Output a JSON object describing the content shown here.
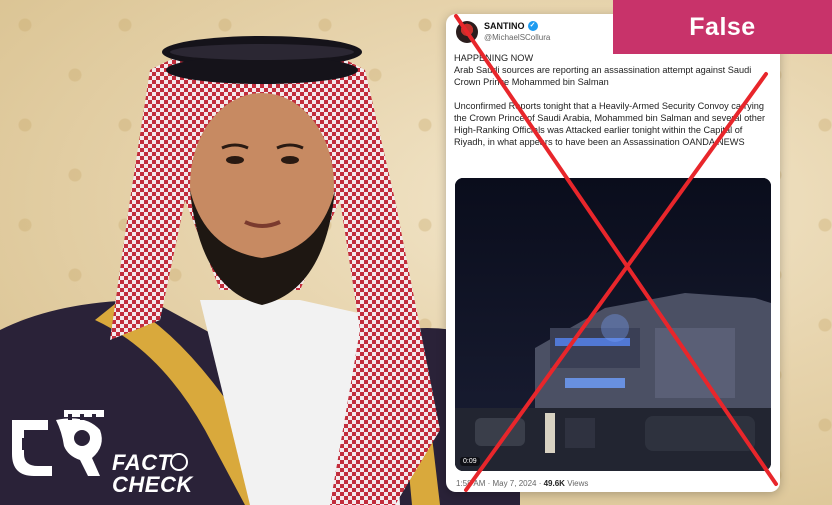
{
  "verdict": {
    "label": "False",
    "color": "#c8336a"
  },
  "tweet": {
    "display_name": "SANTINO",
    "handle": "@MichaelSCollura",
    "paragraphs": [
      "HAPPENING NOW\nArab Saudi sources are reporting an assassination attempt against Saudi Crown Prince Mohammed bin Salman",
      "Unconfirmed Reports tonight that a Heavily-Armed Security Convoy carrying the Crown Prince of Saudi Arabia, Mohammed bin Salman and several other High-Ranking Officials was Attacked earlier tonight within the Capital of Riyadh, in what appears to have been an Assassination OANDA NEWS"
    ],
    "video_time": "0:09",
    "meta_time": "1:58 AM · May 7, 2024 · ",
    "meta_views": "49.6K",
    "meta_views_label": " Views"
  },
  "logo": {
    "word1": "FACT",
    "word2": "CHECK"
  }
}
